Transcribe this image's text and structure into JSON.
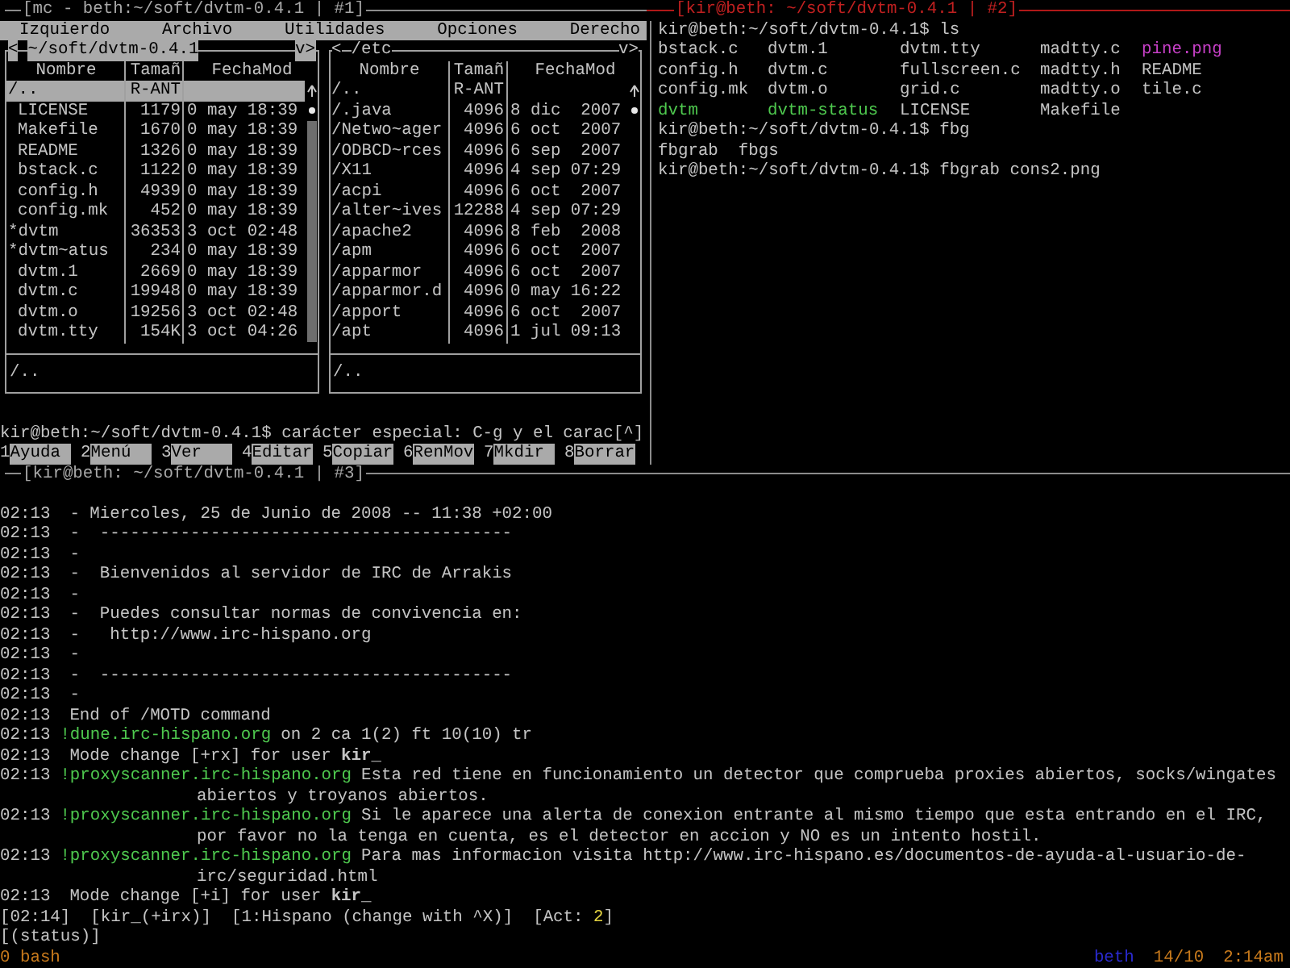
{
  "mc_window": {
    "title": "[mc - beth:~/soft/dvtm-0.4.1 | #1]",
    "focused": false,
    "menu": [
      "Izquierdo",
      "Archivo",
      "Utilidades",
      "Opciones",
      "Derecho"
    ],
    "panels": [
      {
        "back_button": "<",
        "path": "~/soft/dvtm-0.4.1",
        "menu_button": "v>",
        "selected": true,
        "columns": [
          "Nombre",
          "Tamañ",
          "FechaMod"
        ],
        "footer": "/..",
        "rows": [
          {
            "name": "/..",
            "size": "R-ANT",
            "kind": "directory",
            "selected": true
          },
          {
            "name": "LICENSE",
            "size": "1179",
            "modified": "0 may 18:39",
            "kind": "file",
            "selected": false
          },
          {
            "name": "Makefile",
            "size": "1670",
            "modified": "0 may 18:39",
            "kind": "file",
            "selected": false
          },
          {
            "name": "README",
            "size": "1326",
            "modified": "0 may 18:39",
            "kind": "file",
            "selected": false
          },
          {
            "name": "bstack.c",
            "size": "1122",
            "modified": "0 may 18:39",
            "kind": "file",
            "selected": false
          },
          {
            "name": "config.h",
            "size": "4939",
            "modified": "0 may 18:39",
            "kind": "file",
            "selected": false
          },
          {
            "name": "config.mk",
            "size": "452",
            "modified": "0 may 18:39",
            "kind": "file",
            "selected": false
          },
          {
            "name": "*dvtm",
            "size": "36353",
            "modified": "3 oct 02:48",
            "kind": "executable",
            "selected": false
          },
          {
            "name": "*dvtm~atus",
            "size": "234",
            "modified": "0 may 18:39",
            "kind": "executable",
            "selected": false
          },
          {
            "name": "dvtm.1",
            "size": "2669",
            "modified": "0 may 18:39",
            "kind": "file",
            "selected": false
          },
          {
            "name": "dvtm.c",
            "size": "19948",
            "modified": "0 may 18:39",
            "kind": "file",
            "selected": false
          },
          {
            "name": "dvtm.o",
            "size": "19256",
            "modified": "3 oct 02:48",
            "kind": "file",
            "selected": false
          },
          {
            "name": "dvtm.tty",
            "size": "154K",
            "modified": "3 oct 04:26",
            "kind": "file",
            "selected": false
          }
        ]
      },
      {
        "back_button": "<",
        "path": "/etc",
        "menu_button": "v>",
        "selected": false,
        "columns": [
          "Nombre",
          "Tamañ",
          "FechaMod"
        ],
        "footer": "/..",
        "rows": [
          {
            "name": "/..",
            "size": "R-ANT",
            "kind": "directory",
            "selected": false
          },
          {
            "name": "/.java",
            "size": "4096",
            "modified": "8 dic  2007",
            "kind": "directory",
            "selected": false
          },
          {
            "name": "/Netwo~ager",
            "size": "4096",
            "modified": "6 oct  2007",
            "kind": "directory",
            "selected": false
          },
          {
            "name": "/ODBCD~rces",
            "size": "4096",
            "modified": "6 sep  2007",
            "kind": "directory",
            "selected": false
          },
          {
            "name": "/X11",
            "size": "4096",
            "modified": "4 sep 07:29",
            "kind": "directory",
            "selected": false
          },
          {
            "name": "/acpi",
            "size": "4096",
            "modified": "6 oct  2007",
            "kind": "directory",
            "selected": false
          },
          {
            "name": "/alter~ives",
            "size": "12288",
            "modified": "4 sep 07:29",
            "kind": "directory",
            "selected": false
          },
          {
            "name": "/apache2",
            "size": "4096",
            "modified": "8 feb  2008",
            "kind": "directory",
            "selected": false
          },
          {
            "name": "/apm",
            "size": "4096",
            "modified": "6 oct  2007",
            "kind": "directory",
            "selected": false
          },
          {
            "name": "/apparmor",
            "size": "4096",
            "modified": "6 oct  2007",
            "kind": "directory",
            "selected": false
          },
          {
            "name": "/apparmor.d",
            "size": "4096",
            "modified": "0 may 16:22",
            "kind": "directory",
            "selected": false
          },
          {
            "name": "/apport",
            "size": "4096",
            "modified": "6 oct  2007",
            "kind": "directory",
            "selected": false
          },
          {
            "name": "/apt",
            "size": "4096",
            "modified": "1 jul 09:13",
            "kind": "directory",
            "selected": false
          }
        ]
      }
    ],
    "command_line": "kir@beth:~/soft/dvtm-0.4.1$ carácter especial: C-g y el carac[^]",
    "function_keys": [
      {
        "key": "1",
        "label": "Ayuda"
      },
      {
        "key": "2",
        "label": "Menú"
      },
      {
        "key": "3",
        "label": "Ver"
      },
      {
        "key": "4",
        "label": "Editar"
      },
      {
        "key": "5",
        "label": "Copiar"
      },
      {
        "key": "6",
        "label": "RenMov"
      },
      {
        "key": "7",
        "label": "Mkdir"
      },
      {
        "key": "8",
        "label": "Borrar"
      }
    ]
  },
  "shell_window": {
    "title": "[kir@beth: ~/soft/dvtm-0.4.1 | #2]",
    "focused": true,
    "lines": [
      {
        "kind": "command",
        "text": "kir@beth:~/soft/dvtm-0.4.1$ ls"
      },
      {
        "kind": "files",
        "entries": [
          {
            "name": "bstack.c",
            "kind": "file"
          },
          {
            "name": "dvtm.1",
            "kind": "file"
          },
          {
            "name": "dvtm.tty",
            "kind": "file"
          },
          {
            "name": "madtty.c",
            "kind": "file"
          },
          {
            "name": "pine.png",
            "kind": "image"
          },
          {
            "name": "config.h",
            "kind": "file"
          },
          {
            "name": "dvtm.c",
            "kind": "file"
          },
          {
            "name": "fullscreen.c",
            "kind": "file"
          },
          {
            "name": "madtty.h",
            "kind": "file"
          },
          {
            "name": "README",
            "kind": "file"
          },
          {
            "name": "config.mk",
            "kind": "file"
          },
          {
            "name": "dvtm.o",
            "kind": "file"
          },
          {
            "name": "grid.c",
            "kind": "file"
          },
          {
            "name": "madtty.o",
            "kind": "file"
          },
          {
            "name": "tile.c",
            "kind": "file"
          },
          {
            "name": "dvtm",
            "kind": "executable"
          },
          {
            "name": "dvtm-status",
            "kind": "executable"
          },
          {
            "name": "LICENSE",
            "kind": "file"
          },
          {
            "name": "Makefile",
            "kind": "file"
          }
        ]
      },
      {
        "kind": "command",
        "text": "kir@beth:~/soft/dvtm-0.4.1$ fbg"
      },
      {
        "kind": "output",
        "text": "fbgrab  fbgs"
      },
      {
        "kind": "command",
        "text": "kir@beth:~/soft/dvtm-0.4.1$ fbgrab cons2.png"
      }
    ]
  },
  "irc_window": {
    "title": "[kir@beth: ~/soft/dvtm-0.4.1 | #3]",
    "focused": false,
    "log": [
      {
        "time": "02:13",
        "text": "- Miercoles, 25 de Junio de 2008 -- 11:38 +02:00"
      },
      {
        "time": "02:13",
        "text": "-  -----------------------------------------"
      },
      {
        "time": "02:13",
        "text": "-"
      },
      {
        "time": "02:13",
        "text": "-  Bienvenidos al servidor de IRC de Arrakis"
      },
      {
        "time": "02:13",
        "text": "-"
      },
      {
        "time": "02:13",
        "text": "-  Puedes consultar normas de convivencia en:"
      },
      {
        "time": "02:13",
        "text": "-   http://www.irc-hispano.org"
      },
      {
        "time": "02:13",
        "text": "-"
      },
      {
        "time": "02:13",
        "text": "-  -----------------------------------------"
      },
      {
        "time": "02:13",
        "text": "-"
      },
      {
        "time": "02:13",
        "text": "End of /MOTD command"
      },
      {
        "time": "02:13",
        "source": "!dune.irc-hispano.org",
        "text": "on 2 ca 1(2) ft 10(10) tr"
      },
      {
        "time": "02:13",
        "text": "Mode change [+rx] for user **kir_**"
      },
      {
        "time": "02:13",
        "source": "!proxyscanner.irc-hispano.org",
        "text": "Esta red tiene en funcionamiento un detector que comprueba proxies abiertos, socks/wingates abiertos y troyanos abiertos."
      },
      {
        "time": "02:13",
        "source": "!proxyscanner.irc-hispano.org",
        "text": "Si le aparece una alerta de conexion entrante al mismo tiempo que esta entrando en el IRC, por favor no la tenga en cuenta, es el detector en accion y NO es un intento hostil."
      },
      {
        "time": "02:13",
        "source": "!proxyscanner.irc-hispano.org",
        "text": "Para mas informacion visita http://www.irc-hispano.es/documentos-de-ayuda-al-usuario-de-irc/seguridad.html"
      },
      {
        "time": "02:13",
        "text": "Mode change [+i] for user **kir_**"
      }
    ],
    "status_items": [
      "[02:14]",
      "[kir_(+irx)]",
      "[1:Hispano (change with ^X)]"
    ],
    "activity": {
      "prefix": "[Act:",
      "count": "2",
      "suffix": "]"
    },
    "window_list": "[(status)]"
  },
  "screen_status": {
    "window": "0 bash",
    "host": "beth",
    "date": "14/10",
    "time": "2:14am"
  }
}
